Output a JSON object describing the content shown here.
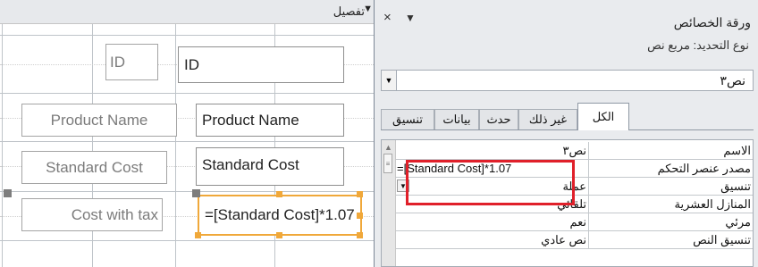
{
  "design_view": {
    "section_label": "تفصيل",
    "section_icon": "arrow-down-icon",
    "controls": [
      {
        "label": "ID",
        "textbox": "ID"
      },
      {
        "label": "Product Name",
        "textbox": "Product Name"
      },
      {
        "label": "Standard Cost",
        "textbox": "Standard Cost"
      },
      {
        "label": "Cost with tax",
        "textbox": "=[Standard Cost]*1.07"
      }
    ],
    "selection_color": "#F0A83A"
  },
  "property_sheet": {
    "title": "ورقة الخصائص",
    "close_icon": "×",
    "menu_icon": "▼",
    "selection_type": "نوع التحديد:  مربع نص",
    "selected_control": "نص٣",
    "tabs": [
      "الكل",
      "غير ذلك",
      "حدث",
      "بيانات",
      "تنسيق"
    ],
    "active_tab": "الكل",
    "properties": [
      {
        "name": "الاسم",
        "value": "نص٣"
      },
      {
        "name": "مصدر عنصر التحكم",
        "value": "=[Standard Cost]*1.07"
      },
      {
        "name": "تنسيق",
        "value": "عملة"
      },
      {
        "name": "المنازل العشرية",
        "value": "تلقائي"
      },
      {
        "name": "مرئي",
        "value": "نعم"
      },
      {
        "name": "تنسيق النص",
        "value": "نص عادي"
      }
    ],
    "highlight_color": "#E0202A"
  }
}
